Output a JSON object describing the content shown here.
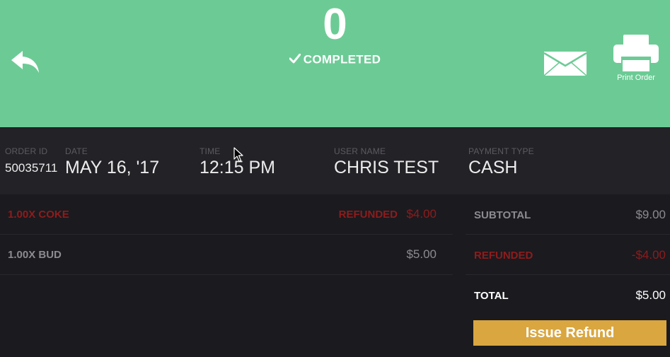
{
  "header": {
    "order_count": "0",
    "status": "COMPLETED",
    "print_label": "Print Order",
    "background_color": "#6ccb95"
  },
  "icons": {
    "back": "reply-arrow-icon",
    "status": "checkmark-icon",
    "email": "envelope-icon",
    "print": "printer-icon"
  },
  "order_info": {
    "order_id": {
      "label": "ORDER ID",
      "value": "50035711"
    },
    "date": {
      "label": "DATE",
      "value": "MAY 16, '17"
    },
    "time": {
      "label": "TIME",
      "value": "12:15 PM"
    },
    "user_name": {
      "label": "USER NAME",
      "value": "CHRIS TEST"
    },
    "payment_type": {
      "label": "PAYMENT TYPE",
      "value": "CASH"
    }
  },
  "items": [
    {
      "name": "1.00X COKE",
      "status": "REFUNDED",
      "price": "$4.00"
    },
    {
      "name": "1.00X BUD",
      "status": "",
      "price": "$5.00"
    }
  ],
  "summary": {
    "subtotal": {
      "label": "SUBTOTAL",
      "value": "$9.00"
    },
    "refunded": {
      "label": "REFUNDED",
      "value": "-$4.00"
    },
    "total": {
      "label": "TOTAL",
      "value": "$5.00"
    }
  },
  "actions": {
    "issue_refund": "Issue Refund",
    "button_color": "#d9a640"
  },
  "colors": {
    "refunded_text": "#8e1c1c",
    "muted_text": "#8c8b90"
  }
}
